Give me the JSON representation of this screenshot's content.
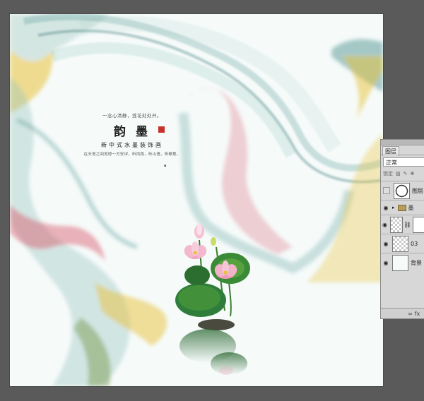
{
  "artwork": {
    "tagline": "一念心清静，莲花处处开。",
    "title": "韵 墨",
    "series": "新中式水墨装饰画",
    "description": "在天地之间觅得一方安详，听风雨，听山语，听禅意。"
  },
  "layers_panel": {
    "tab_label": "图层",
    "blend_mode": "正常",
    "lock_label": "锁定",
    "layers": [
      {
        "name": "图层",
        "thumb": "circle"
      },
      {
        "name": "墨",
        "thumb": "folder"
      },
      {
        "name": "",
        "thumb": "checker"
      },
      {
        "name": "03",
        "thumb": "checker"
      },
      {
        "name": "背景",
        "thumb": "plain"
      }
    ],
    "footer_fx": "fx"
  },
  "colors": {
    "workspace": "#5a5a5a",
    "canvas": "#f6fbfa",
    "teal_ink": "#3e8a86",
    "pink_ink": "#d9566a",
    "yellow_ink": "#e8c23a",
    "lotus_pink": "#f0a6c0",
    "leaf_green": "#2f7d3a",
    "seal_red": "#c8302c"
  }
}
